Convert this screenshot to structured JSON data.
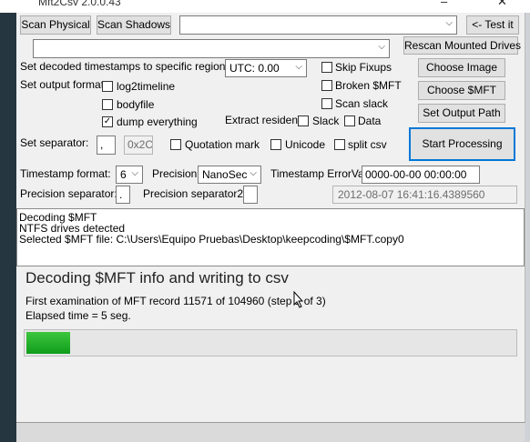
{
  "window": {
    "title": "Mft2Csv 2.0.0.43",
    "min": "–",
    "close": "✕"
  },
  "top": {
    "scan_physical": "Scan Physical",
    "scan_shadows": "Scan Shadows",
    "volume_select": "",
    "test_button": "<- Test it",
    "second_select": "",
    "rescan_button": "Rescan Mounted Drives"
  },
  "options": {
    "region_label": "Set decoded timestamps to specific region:",
    "region_value": "UTC: 0.00",
    "skip_fixups": "Skip Fixups",
    "broken_mft": "Broken $MFT",
    "scan_slack": "Scan slack",
    "output_format_label": "Set output format:",
    "log2timeline": "log2timeline",
    "bodyfile": "bodyfile",
    "dump_everything": "dump everything",
    "extract_resident_label": "Extract resident:",
    "slack": "Slack",
    "data": "Data",
    "separator_label": "Set separator:",
    "separator_value": ",",
    "separator_hex": "0x2C",
    "quotation_mark": "Quotation mark",
    "unicode": "Unicode",
    "split_csv": "split csv",
    "timestamp_format_label": "Timestamp format:",
    "timestamp_format_value": "6",
    "precision_label": "Precision:",
    "precision_value": "NanoSec",
    "timestamp_errorval_label": "Timestamp ErrorVal:",
    "timestamp_errorval_value": "0000-00-00 00:00:00",
    "precision_separator_label": "Precision separator:",
    "precision_separator_value": ".",
    "precision_separator2_label": "Precision separator2:",
    "precision_separator2_value": "",
    "example_timestamp": "2012-08-07 16:41:16.4389560"
  },
  "actions": {
    "choose_image": "Choose Image",
    "choose_mft": "Choose $MFT",
    "set_output_path": "Set Output Path",
    "start_processing": "Start Processing"
  },
  "log": [
    "Decoding $MFT",
    "NTFS drives detected",
    "Selected $MFT file: C:\\Users\\Equipo Pruebas\\Desktop\\keepcoding\\$MFT.copy0"
  ],
  "status": {
    "heading": "Decoding $MFT info and writing to csv",
    "line1": "First examination of MFT record 11571 of 104960 (step 1 of 3)",
    "line2": "Elapsed time = 5 seg.",
    "progress_fraction": 0.09
  },
  "colors": {
    "focus": "#0078d7",
    "progress": "#0f9d1c"
  }
}
